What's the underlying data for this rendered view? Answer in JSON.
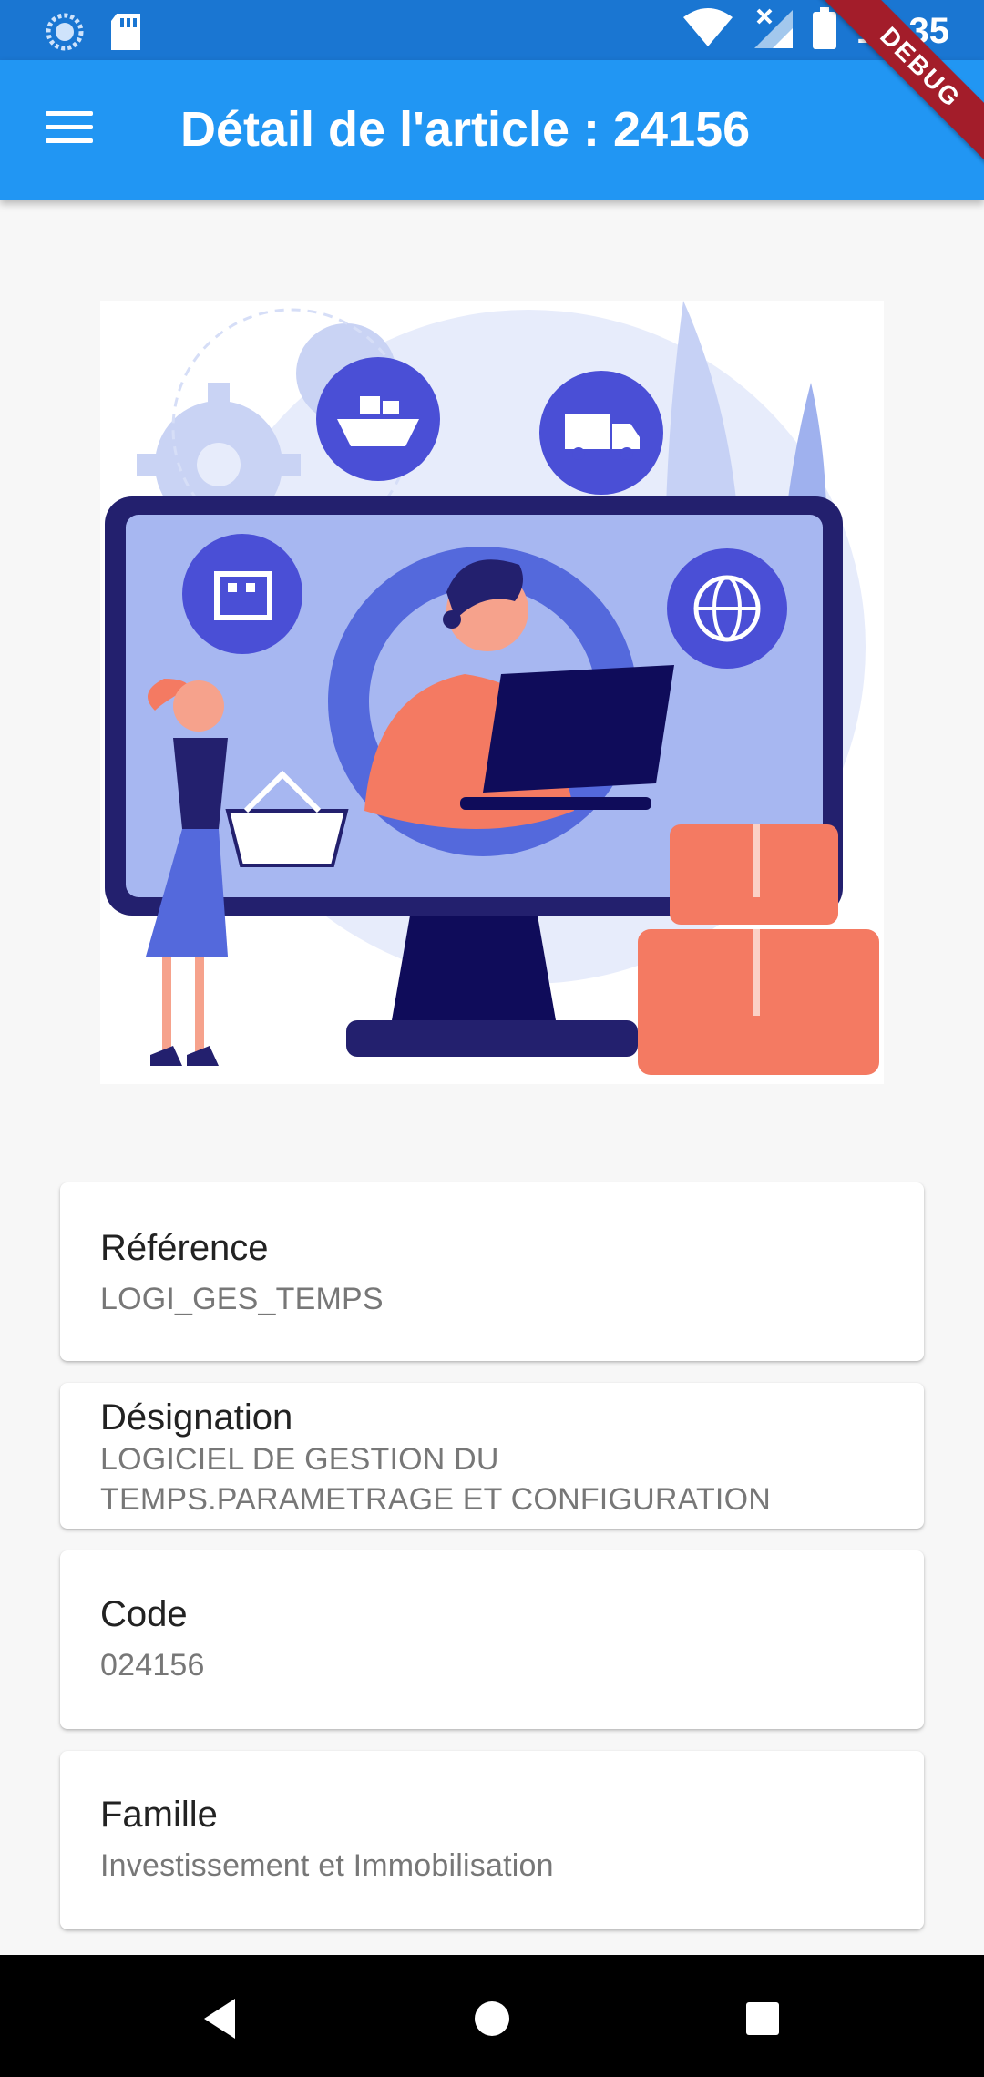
{
  "status_bar": {
    "time": "10:35",
    "icons": [
      "data-saver-icon",
      "sd-card-icon",
      "wifi-icon",
      "cell-signal-icon",
      "battery-icon"
    ]
  },
  "debug_banner": "DEBUG",
  "app_bar": {
    "menu_icon": "hamburger-menu-icon",
    "title": "Détail de l'article : 24156",
    "color": "#2196f3"
  },
  "illustration": "logistics-illustration",
  "details": [
    {
      "label": "Référence",
      "value": "LOGI_GES_TEMPS"
    },
    {
      "label": "Désignation",
      "value_lines": [
        "LOGICIEL DE GESTION DU",
        "TEMPS.PARAMETRAGE ET CONFIGURATION"
      ]
    },
    {
      "label": "Code",
      "value": "024156"
    },
    {
      "label": "Famille",
      "value": "Investissement et Immobilisation"
    }
  ],
  "nav_bar": {
    "buttons": [
      "back-icon",
      "home-icon",
      "recents-icon"
    ]
  }
}
